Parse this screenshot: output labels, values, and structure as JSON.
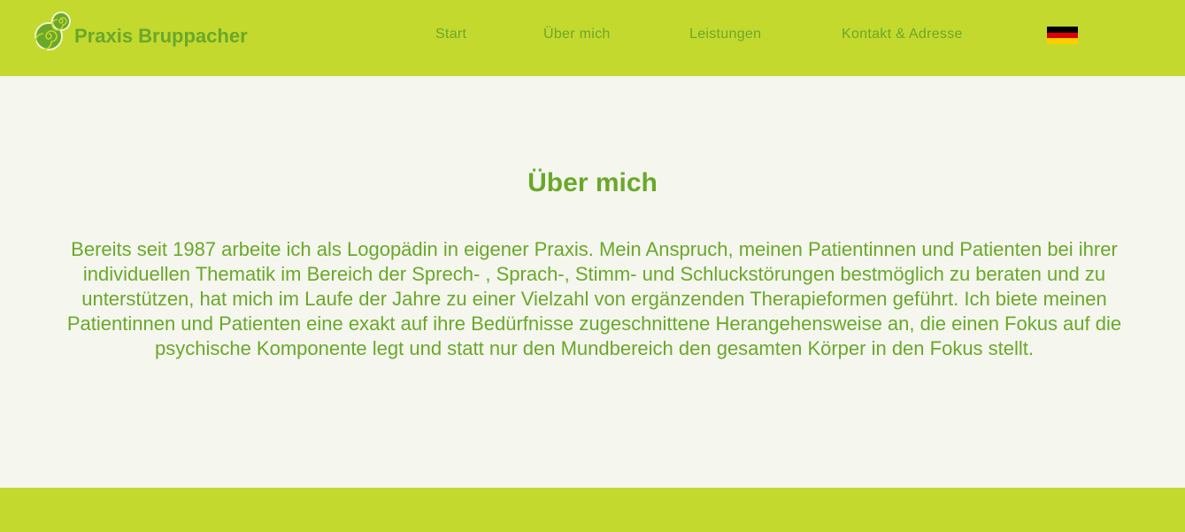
{
  "header": {
    "brand": "Praxis Bruppacher",
    "logo_icon": "spiral-logo-icon",
    "nav": [
      {
        "label": "Start"
      },
      {
        "label": "Über mich"
      },
      {
        "label": "Leistungen"
      },
      {
        "label": "Kontakt & Adresse"
      }
    ],
    "language_icon": "german-flag-icon"
  },
  "main": {
    "title": "Über mich",
    "text": "Bereits seit 1987 arbeite ich als Logopädin in eigener Praxis. Mein Anspruch, meinen Patientinnen und Patienten bei ihrer individuellen Thematik im Bereich der Sprech- , Sprach-, Stimm- und Schluckstörungen bestmöglich zu beraten und zu unterstützen, hat mich im Laufe der Jahre zu einer Vielzahl von ergänzenden Therapieformen geführt. Ich biete meinen Patientinnen und Patienten eine exakt auf ihre Bedürfnisse zugeschnittene Herangehensweise an, die einen Fokus auf die psychische Komponente legt und statt nur den Mundbereich den gesamten Körper in den Fokus stellt."
  },
  "colors": {
    "header_bg": "#c4d92e",
    "page_bg": "#f5f6ee",
    "text_green": "#6aa82a",
    "flag_black": "#000000",
    "flag_red": "#dd0000",
    "flag_gold": "#ffce00"
  }
}
